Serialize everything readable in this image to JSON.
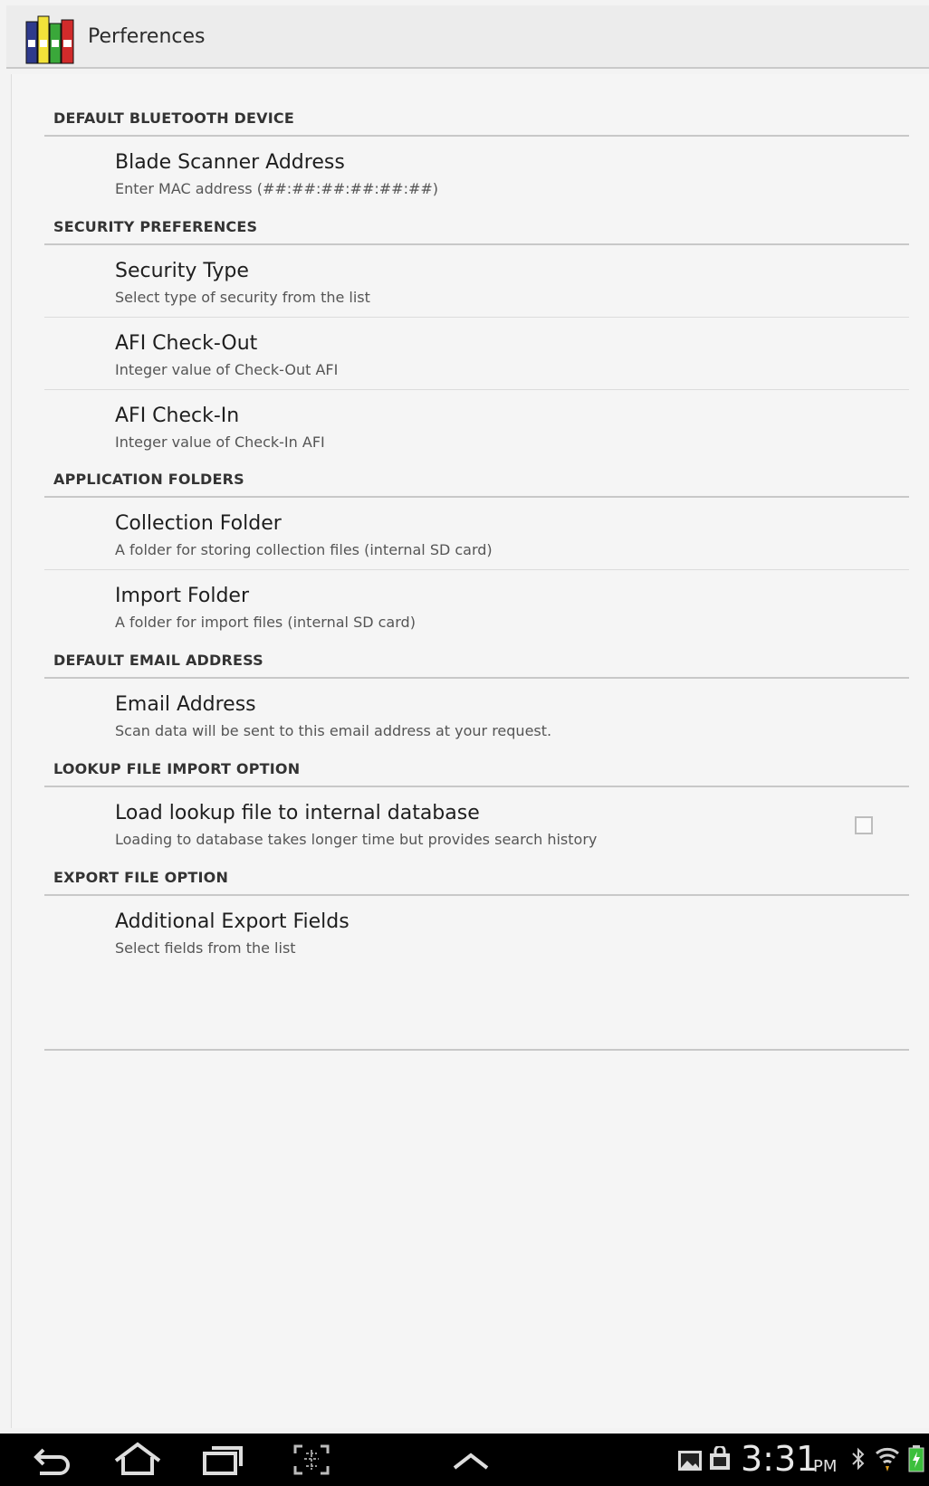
{
  "app": {
    "title": "Perferences",
    "icon": "books-icon"
  },
  "sections": [
    {
      "header": "DEFAULT BLUETOOTH DEVICE",
      "items": [
        {
          "title": "Blade Scanner Address",
          "summary": "Enter MAC address (##:##:##:##:##:##)"
        }
      ]
    },
    {
      "header": "SECURITY PREFERENCES",
      "items": [
        {
          "title": "Security Type",
          "summary": "Select type of security from the list"
        },
        {
          "title": "AFI Check-Out",
          "summary": "Integer value of Check-Out AFI"
        },
        {
          "title": "AFI Check-In",
          "summary": "Integer value of Check-In AFI"
        }
      ]
    },
    {
      "header": "APPLICATION FOLDERS",
      "items": [
        {
          "title": "Collection Folder",
          "summary": "A folder for storing collection files (internal SD card)"
        },
        {
          "title": "Import Folder",
          "summary": "A folder for import files (internal SD card)"
        }
      ]
    },
    {
      "header": "DEFAULT EMAIL ADDRESS",
      "items": [
        {
          "title": "Email Address",
          "summary": "Scan data will be sent to this email address at your request."
        }
      ]
    },
    {
      "header": "LOOKUP FILE IMPORT OPTION",
      "items": [
        {
          "title": "Load lookup file to internal database",
          "summary": "Loading to database takes longer time but provides search history",
          "checked": false
        }
      ]
    },
    {
      "header": "EXPORT FILE OPTION",
      "items": [
        {
          "title": "Additional Export Fields",
          "summary": "Select fields from the list"
        }
      ]
    }
  ],
  "status_bar": {
    "time": "3:31",
    "ampm": "PM",
    "icons": [
      "gallery-icon",
      "shopping-bag-icon",
      "bluetooth-icon",
      "wifi-icon",
      "battery-charging-icon"
    ]
  },
  "nav_bar": {
    "buttons": [
      "back-icon",
      "home-icon",
      "recent-apps-icon",
      "screenshot-icon",
      "up-arrow-icon"
    ]
  },
  "colors": {
    "background": "#f5f5f5",
    "divider": "#c8c8c8",
    "nav_bar": "#000000"
  }
}
